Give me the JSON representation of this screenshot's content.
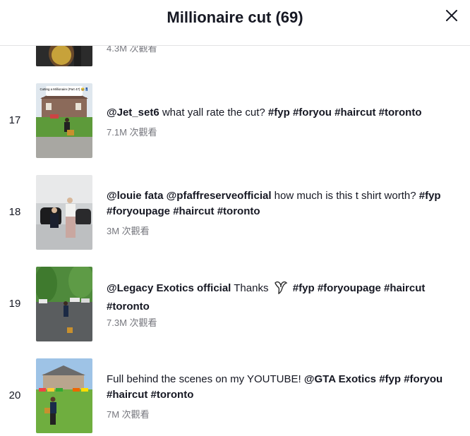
{
  "header": {
    "title": "Millionaire cut (69)"
  },
  "top_partial": {
    "views": "4.3M 次觀看"
  },
  "items": [
    {
      "index": "17",
      "thumb_caption": "Cutting a Millionaire (Part 47) 😂👖",
      "parts": [
        {
          "t": "@Jet_set6",
          "k": "mention"
        },
        {
          "t": " what yall rate the cut? ",
          "k": "plain"
        },
        {
          "t": "#fyp",
          "k": "tag"
        },
        {
          "t": " ",
          "k": "plain"
        },
        {
          "t": "#foryou",
          "k": "tag"
        },
        {
          "t": " ",
          "k": "plain"
        },
        {
          "t": "#haircut",
          "k": "tag"
        },
        {
          "t": " ",
          "k": "plain"
        },
        {
          "t": "#toronto",
          "k": "tag"
        }
      ],
      "views": "7.1M 次觀看"
    },
    {
      "index": "18",
      "parts": [
        {
          "t": "@louie fata",
          "k": "mention"
        },
        {
          "t": " ",
          "k": "plain"
        },
        {
          "t": "@pfaffreserveofficial",
          "k": "mention"
        },
        {
          "t": " how much is this t shirt worth? ",
          "k": "plain"
        },
        {
          "t": "#fyp",
          "k": "tag"
        },
        {
          "t": " ",
          "k": "plain"
        },
        {
          "t": "#foryoupage",
          "k": "tag"
        },
        {
          "t": " ",
          "k": "plain"
        },
        {
          "t": "#haircut",
          "k": "tag"
        },
        {
          "t": " ",
          "k": "plain"
        },
        {
          "t": "#toronto",
          "k": "tag"
        }
      ],
      "views": "3M 次觀看"
    },
    {
      "index": "19",
      "parts": [
        {
          "t": "@Legacy Exotics official",
          "k": "mention"
        },
        {
          "t": " Thanks ",
          "k": "plain"
        },
        {
          "t": "🕊",
          "k": "emoji"
        },
        {
          "t": " ",
          "k": "plain"
        },
        {
          "t": "#fyp",
          "k": "tag"
        },
        {
          "t": " ",
          "k": "plain"
        },
        {
          "t": "#foryoupage",
          "k": "tag"
        },
        {
          "t": " ",
          "k": "plain"
        },
        {
          "t": "#haircut",
          "k": "tag"
        },
        {
          "t": " ",
          "k": "plain"
        },
        {
          "t": "#toronto",
          "k": "tag"
        }
      ],
      "views": "7.3M 次觀看"
    },
    {
      "index": "20",
      "parts": [
        {
          "t": "Full behind the scenes on my YOUTUBE! ",
          "k": "plain"
        },
        {
          "t": "@GTA Exotics",
          "k": "mention"
        },
        {
          "t": " ",
          "k": "plain"
        },
        {
          "t": "#fyp",
          "k": "tag"
        },
        {
          "t": " ",
          "k": "plain"
        },
        {
          "t": "#foryou",
          "k": "tag"
        },
        {
          "t": " ",
          "k": "plain"
        },
        {
          "t": "#haircut",
          "k": "tag"
        },
        {
          "t": " ",
          "k": "plain"
        },
        {
          "t": "#toronto",
          "k": "tag"
        }
      ],
      "views": "7M 次觀看"
    }
  ],
  "colors": {
    "text": "#161823",
    "muted": "#8a8b91",
    "divider": "#e3e3e4"
  },
  "icons": {
    "close": "close-icon",
    "emoji_bird": "bird-emoji-icon"
  }
}
